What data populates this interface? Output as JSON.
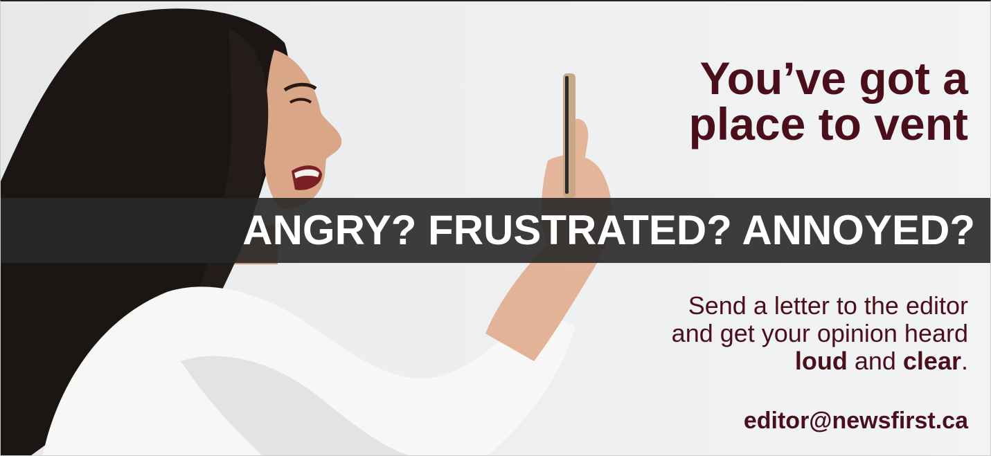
{
  "headline": {
    "line1": "You’ve got a",
    "line2": "place to vent"
  },
  "banner": {
    "text": "ANGRY? FRUSTRATED? ANNOYED?"
  },
  "body": {
    "line1": "Send a letter to the editor",
    "line2": "and get your opinion heard",
    "loud": "loud",
    "and": " and ",
    "clear": "clear",
    "period": "."
  },
  "contact": {
    "email": "editor@newsfirst.ca"
  },
  "colors": {
    "accent": "#4a0f1a",
    "banner_bg": "#2a2a2a",
    "banner_text": "#ffffff",
    "background": "#eceef0"
  },
  "image": {
    "subject": "woman-shouting-at-phone"
  }
}
